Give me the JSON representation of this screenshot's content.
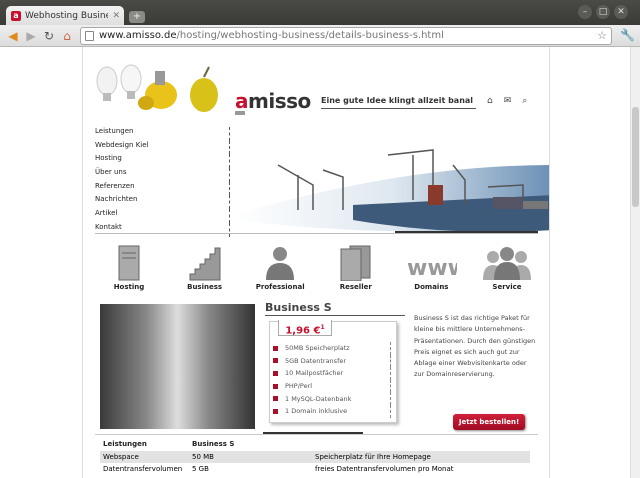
{
  "browser": {
    "tab_title": "Webhosting Business S - a",
    "tab_favicon": "a",
    "url_host": "www.amisso.de",
    "url_path": "/hosting/webhosting-business/details-business-s.html"
  },
  "site": {
    "logo_prefix": "a",
    "logo_rest": "misso",
    "slogan": "Eine gute Idee klingt allzeit banal",
    "header_icons": [
      "home-icon",
      "mail-icon",
      "search-icon"
    ],
    "accent_color": "#c8102e"
  },
  "nav": [
    "Leistungen",
    "Webdesign Kiel",
    "Hosting",
    "Über uns",
    "Referenzen",
    "Nachrichten",
    "Artikel",
    "Kontakt"
  ],
  "categories": [
    {
      "label": "Hosting",
      "icon": "server-tower-icon"
    },
    {
      "label": "Business",
      "icon": "stairs-icon"
    },
    {
      "label": "Professional",
      "icon": "person-icon"
    },
    {
      "label": "Reseller",
      "icon": "multiple-servers-icon"
    },
    {
      "label": "Domains",
      "icon": "www-icon"
    },
    {
      "label": "Service",
      "icon": "group-icon"
    }
  ],
  "product": {
    "title": "Business S",
    "price": "1,96 €",
    "price_sup": "1",
    "features": [
      "50MB Speicherplatz",
      "5GB Datentransfer",
      "10 Mailpostfächer",
      "PHP/Perl",
      "1 MySQL-Datenbank",
      "1 Domain inklusive"
    ],
    "description": "Business S ist das richtige Paket für kleine bis mittlere Unternehmens-Präsentationen. Durch den günstigen Preis eignet es sich auch gut zur Ablage einer Webvisitenkarte oder zur Domainreservierung.",
    "order_label": "Jetzt bestellen!"
  },
  "table": {
    "headers": [
      "Leistungen",
      "Business S",
      ""
    ],
    "rows": [
      [
        "Webspace",
        "50 MB",
        "Speicherplatz für Ihre Homepage"
      ],
      [
        "Datentransfervolumen",
        "5 GB",
        "freies Datentransfervolumen pro Monat"
      ]
    ]
  }
}
